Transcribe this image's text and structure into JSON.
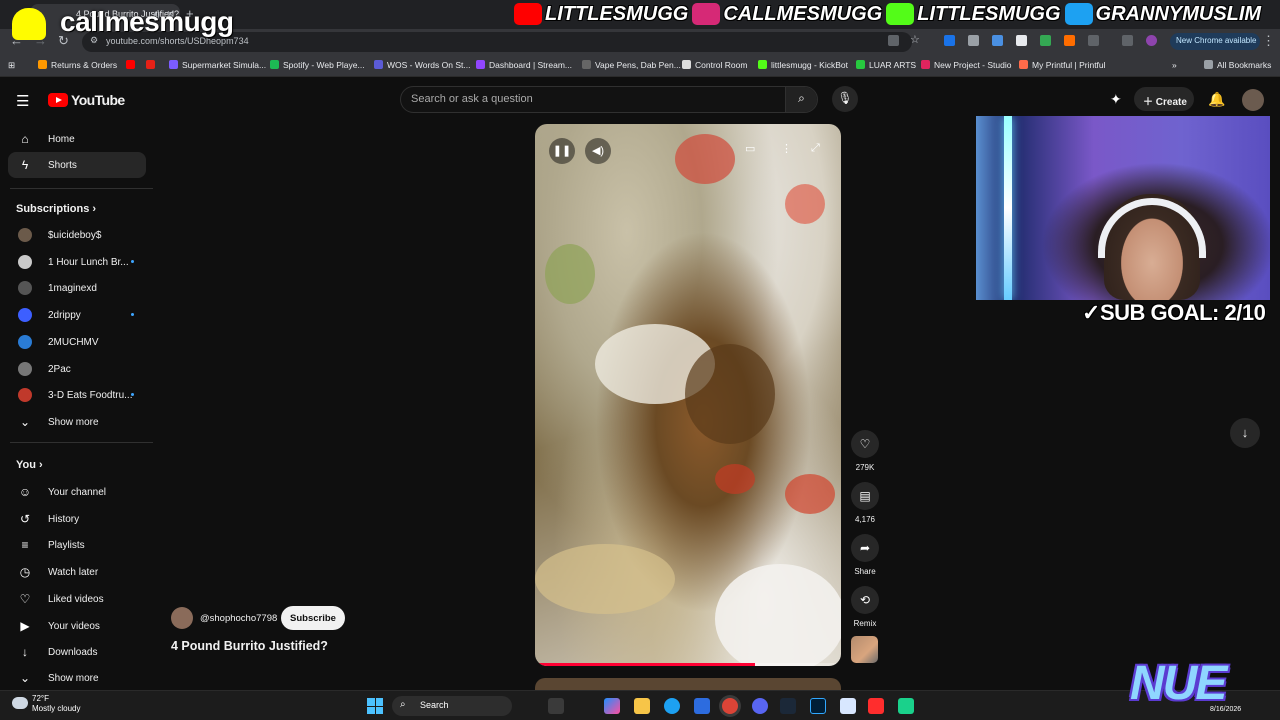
{
  "browser": {
    "tab_title": "4 Pound Burrito Justified?",
    "url": "youtube.com/shorts/USDheopm734",
    "new_chrome": "New Chrome available",
    "bookmarks": [
      {
        "label": "Returns & Orders",
        "color": "#ff9900"
      },
      {
        "label": "",
        "color": "#ff0000"
      },
      {
        "label": "",
        "color": "#e62117"
      },
      {
        "label": "Supermarket Simula...",
        "color": "#7b5cff"
      },
      {
        "label": "Spotify - Web Playe...",
        "color": "#1db954"
      },
      {
        "label": "WOS - Words On St...",
        "color": "#5b5bd6"
      },
      {
        "label": "Dashboard | Stream...",
        "color": "#9146ff"
      },
      {
        "label": "Vape Pens, Dab Pen...",
        "color": "#666666"
      },
      {
        "label": "Control Room",
        "color": "#dddddd"
      },
      {
        "label": "littlesmugg - KickBot",
        "color": "#53fc18"
      },
      {
        "label": "LUAR ARTS",
        "color": "#27c93f"
      },
      {
        "label": "New Project - Studio",
        "color": "#e0245e"
      },
      {
        "label": "My Printful | Printful",
        "color": "#ff6b4a"
      }
    ],
    "all_bookmarks": "All Bookmarks"
  },
  "overlay": {
    "name": "callmesmugg",
    "socials": [
      {
        "label": "LITTLESMUGG",
        "color": "#ff0000"
      },
      {
        "label": "CALLMESMUGG",
        "color": "#d62976"
      },
      {
        "label": "LITTLESMUGG",
        "color": "#53fc18"
      },
      {
        "label": "GRANNYMUSLIM",
        "color": "#1da1f2"
      }
    ],
    "sub_goal": "SUB GOAL: 2/10",
    "logo": "NUE"
  },
  "youtube": {
    "logo_text": "YouTube",
    "search_placeholder": "Search or ask a question",
    "create_label": "Create",
    "sidebar": {
      "main": [
        {
          "label": "Home",
          "icon": "home-icon",
          "glyph": "⌂"
        },
        {
          "label": "Shorts",
          "icon": "shorts-icon",
          "glyph": "ϟ"
        }
      ],
      "subscriptions_heading": "Subscriptions",
      "subscriptions": [
        {
          "label": "$uicideboy$",
          "color": "#6b5a4a",
          "dot": false
        },
        {
          "label": "1 Hour Lunch Br...",
          "color": "#c9c9c9",
          "dot": true
        },
        {
          "label": "1maginexd",
          "color": "#555555",
          "dot": false
        },
        {
          "label": "2drippy",
          "color": "#3d5fff",
          "dot": true
        },
        {
          "label": "2MUCHMV",
          "color": "#2a7bd4",
          "dot": false
        },
        {
          "label": "2Pac",
          "color": "#777777",
          "dot": false
        },
        {
          "label": "3-D Eats Foodtru...",
          "color": "#c0392b",
          "dot": true
        }
      ],
      "show_more": "Show more",
      "you_heading": "You",
      "you": [
        {
          "label": "Your channel",
          "glyph": "☺"
        },
        {
          "label": "History",
          "glyph": "↺"
        },
        {
          "label": "Playlists",
          "glyph": "≡"
        },
        {
          "label": "Watch later",
          "glyph": "◷"
        },
        {
          "label": "Liked videos",
          "glyph": "♡"
        },
        {
          "label": "Your videos",
          "glyph": "▶"
        },
        {
          "label": "Downloads",
          "glyph": "↓"
        }
      ],
      "show_more_2": "Show more"
    },
    "short": {
      "likes": "279K",
      "comments": "4,176",
      "share": "Share",
      "remix": "Remix",
      "channel": "@shophocho7798",
      "subscribe": "Subscribe",
      "title": "4 Pound Burrito Justified?",
      "progress": 0.72
    }
  },
  "taskbar": {
    "temp": "72°F",
    "weather": "Mostly cloudy",
    "search": "Search",
    "date": "8/16/2026"
  }
}
